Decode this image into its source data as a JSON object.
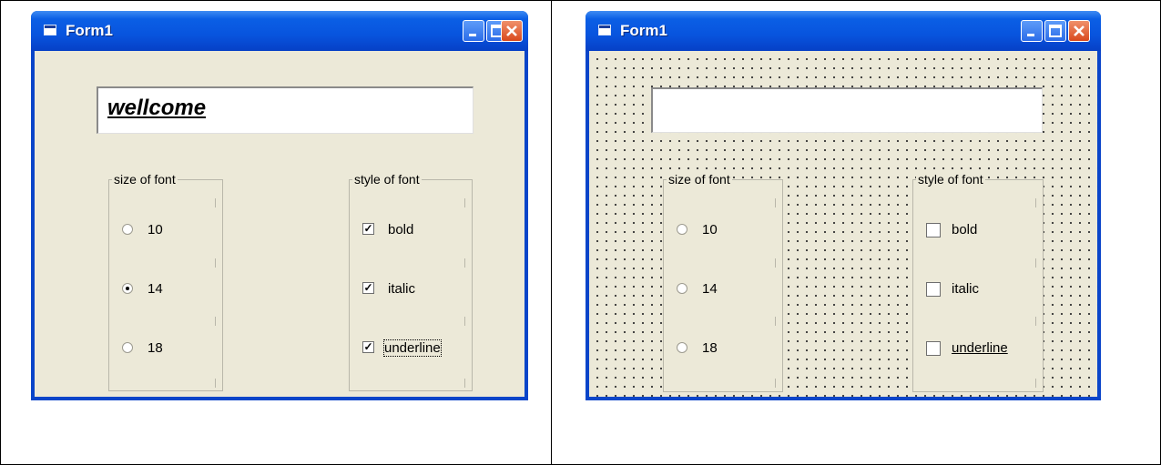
{
  "left_window": {
    "title": "Form1",
    "textbox_value": "wellcome",
    "size_frame": {
      "label": "size of font",
      "options": [
        {
          "label": "10",
          "selected": false
        },
        {
          "label": "14",
          "selected": true
        },
        {
          "label": "18",
          "selected": false
        }
      ]
    },
    "style_frame": {
      "label": "style of font",
      "options": [
        {
          "label": "bold",
          "checked": true
        },
        {
          "label": "italic",
          "checked": true
        },
        {
          "label": "underline",
          "checked": true
        }
      ]
    }
  },
  "right_window": {
    "title": "Form1",
    "textbox_value": "",
    "size_frame": {
      "label": "size of font",
      "options": [
        {
          "label": "10",
          "selected": false
        },
        {
          "label": "14",
          "selected": false
        },
        {
          "label": "18",
          "selected": false
        }
      ]
    },
    "style_frame": {
      "label": "style of font",
      "options": [
        {
          "label": "bold",
          "checked": false
        },
        {
          "label": "italic",
          "checked": false
        },
        {
          "label": "underline",
          "checked": false
        }
      ]
    }
  },
  "icons": {
    "window": "form-icon",
    "minimize": "minimize-icon",
    "maximize": "maximize-icon",
    "close": "close-icon"
  },
  "colors": {
    "titlebar": "#0854de",
    "client_background": "#ece9d8",
    "close_button": "#d9491d"
  }
}
